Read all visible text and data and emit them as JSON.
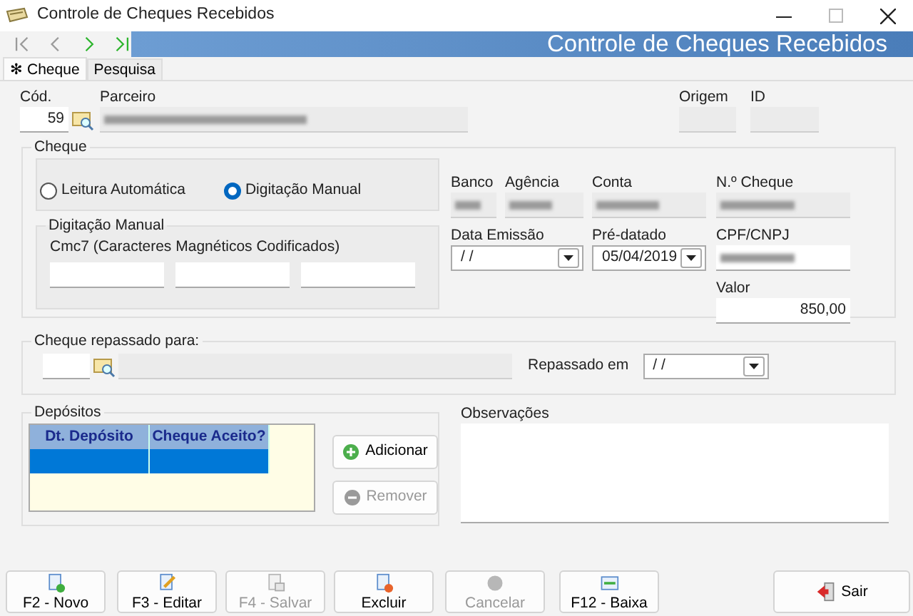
{
  "window": {
    "title": "Controle de Cheques Recebidos"
  },
  "nav_buttons": [
    {
      "kind": "first",
      "disabled": true
    },
    {
      "kind": "prev",
      "disabled": true
    },
    {
      "kind": "next",
      "disabled": false
    },
    {
      "kind": "last",
      "disabled": false
    }
  ],
  "header": {
    "title": "Controle de Cheques Recebidos"
  },
  "tabs": [
    {
      "label": "Cheque",
      "marker": "✻",
      "selected": true
    },
    {
      "label": "Pesquisa",
      "selected": false
    }
  ],
  "record": {
    "cod": {
      "label": "Cód.",
      "value": "59"
    },
    "parceiro": {
      "label": "Parceiro",
      "blurred": true
    },
    "origem": {
      "label": "Origem"
    },
    "id": {
      "label": "ID"
    }
  },
  "cheque": {
    "title": "Cheque",
    "read_mode": [
      {
        "label": "Leitura Automática",
        "selected": false
      },
      {
        "label": "Digitação Manual",
        "selected": true
      }
    ],
    "manual": {
      "title": "Digitação Manual",
      "cmc7_label": "Cmc7 (Caracteres Magnéticos Codificados)"
    },
    "banco": {
      "label": "Banco",
      "blurred": true
    },
    "agencia": {
      "label": "Agência",
      "blurred": true
    },
    "conta": {
      "label": "Conta",
      "blurred": true
    },
    "numero": {
      "label": "N.º Cheque",
      "blurred": true
    },
    "data_emissao": {
      "label": "Data Emissão",
      "value": "/  /"
    },
    "pre_datado": {
      "label": "Pré-datado",
      "value": "05/04/2019"
    },
    "cpf_cnpj": {
      "label": "CPF/CNPJ",
      "blurred": true
    },
    "valor": {
      "label": "Valor",
      "value": "850,00"
    }
  },
  "repasse": {
    "title": "Cheque repassado para:",
    "date_label": "Repassado em",
    "date_value": "/  /"
  },
  "depositos": {
    "title": "Depósitos",
    "columns": [
      "Dt. Depósito",
      "Cheque Aceito?"
    ],
    "rows": [
      {
        "selected": true
      }
    ],
    "buttons": [
      {
        "kind": "add",
        "label": "Adicionar",
        "disabled": false
      },
      {
        "kind": "remove",
        "label": "Remover",
        "disabled": true
      }
    ]
  },
  "observacoes": {
    "label": "Observações"
  },
  "toolbar": [
    {
      "kind": "new",
      "label": "F2 - Novo",
      "disabled": false
    },
    {
      "kind": "edit",
      "label": "F3 - Editar",
      "disabled": false
    },
    {
      "kind": "save",
      "label": "F4 - Salvar",
      "disabled": true
    },
    {
      "kind": "delete",
      "label": "Excluir",
      "disabled": false
    },
    {
      "kind": "cancel",
      "label": "Cancelar",
      "disabled": true
    },
    {
      "kind": "settle",
      "label": "F12 - Baixa",
      "disabled": false
    },
    {
      "kind": "exit",
      "label": "Sair",
      "disabled": false
    }
  ]
}
